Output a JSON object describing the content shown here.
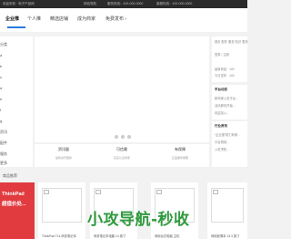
{
  "topbar": {
    "welcome": "欢迎来到 · 电子产品网",
    "menu": "网站导航",
    "service": "服务热线：400-000-0000",
    "tips": "客服热线：400-000-0000"
  },
  "header": {
    "tabs": [
      {
        "label": "企业推",
        "active": true
      },
      {
        "label": "个人推",
        "active": false
      },
      {
        "label": "精选店铺",
        "active": false
      },
      {
        "label": "成为商家",
        "active": false
      },
      {
        "label": "免费发布 ›",
        "active": false
      }
    ]
  },
  "leftnav": {
    "items": [
      "分类",
      "a",
      "b",
      "c",
      "d",
      "e",
      "f",
      "g",
      "资讯",
      "配件",
      "服务",
      "更多"
    ]
  },
  "stats": [
    {
      "title": "资讯量",
      "sub": "最新资讯更新"
    },
    {
      "title": "可信赖",
      "sub": "实名认证商家"
    },
    {
      "title": "有保障",
      "sub": "正品服务保障"
    }
  ],
  "right": {
    "links": [
      "首页",
      "配件",
      "服务",
      "知识",
      "更多"
    ],
    "login": "登录 / 注册",
    "lines": [
      "最新商品 · 100",
      "今日发布 · 100"
    ],
    "notice_title": "平台动态",
    "notice": [
      "新商家入驻平台…",
      "活动即将开始…",
      "欢迎加入…"
    ],
    "company_title": "行业资讯",
    "company": [
      "“企业推”助力商家…",
      "平台规则…",
      "入驻须知…"
    ]
  },
  "section": {
    "title": "商品推荐"
  },
  "promo": {
    "line1": "ThinkPad",
    "line2": "超值价处..."
  },
  "cards": [
    {
      "name": "ThinkPad T14 商务笔记本"
    },
    {
      "name": "商务笔记本电脑 14 英寸"
    },
    {
      "name": "商用台式电脑 主机"
    },
    {
      "name": "商用轻薄本 13.3 英寸"
    }
  ],
  "watermark": "小攻导航-秒收"
}
